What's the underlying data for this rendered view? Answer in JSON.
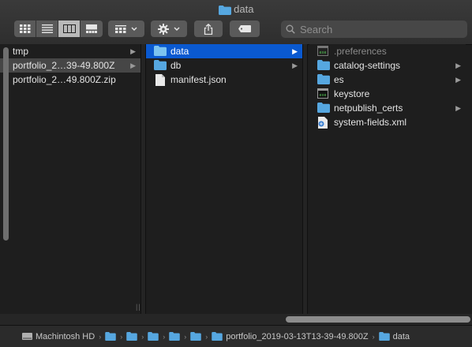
{
  "window": {
    "title": "data"
  },
  "toolbar": {
    "views": [
      "icon-view",
      "list-view",
      "column-view",
      "gallery-view"
    ],
    "active_view": "column-view",
    "group_button": "group-by",
    "action_button": "action-gear",
    "share_button": "share",
    "tag_button": "tags"
  },
  "search": {
    "placeholder": "Search",
    "value": ""
  },
  "columns": [
    {
      "items": [
        {
          "label": "tmp",
          "kind": "folder",
          "arrow": true
        },
        {
          "label": "portfolio_2…39-49.800Z",
          "kind": "folder",
          "arrow": true,
          "state": "parentsel"
        },
        {
          "label": "portfolio_2…49.800Z.zip",
          "kind": "file",
          "arrow": false
        }
      ]
    },
    {
      "items": [
        {
          "label": "data",
          "kind": "folder",
          "arrow": true,
          "state": "sel"
        },
        {
          "label": "db",
          "kind": "folder",
          "arrow": true
        },
        {
          "label": "manifest.json",
          "kind": "doc",
          "arrow": false
        }
      ]
    },
    {
      "items": [
        {
          "label": ".preferences",
          "kind": "exec",
          "arrow": false,
          "state": "dim"
        },
        {
          "label": "catalog-settings",
          "kind": "folder",
          "arrow": true
        },
        {
          "label": "es",
          "kind": "folder",
          "arrow": true
        },
        {
          "label": "keystore",
          "kind": "exec",
          "arrow": false
        },
        {
          "label": "netpublish_certs",
          "kind": "folder",
          "arrow": true
        },
        {
          "label": "system-fields.xml",
          "kind": "xml",
          "arrow": false
        }
      ]
    }
  ],
  "pathbar": [
    {
      "label": "Machintosh HD",
      "kind": "disk"
    },
    {
      "label": "",
      "kind": "folder"
    },
    {
      "label": "",
      "kind": "folder"
    },
    {
      "label": "",
      "kind": "folder"
    },
    {
      "label": "",
      "kind": "folder"
    },
    {
      "label": "",
      "kind": "folder"
    },
    {
      "label": "portfolio_2019-03-13T13-39-49.800Z",
      "kind": "folder"
    },
    {
      "label": "data",
      "kind": "folder"
    }
  ],
  "colors": {
    "selection": "#0a59d0",
    "folder": "#56a7e0",
    "background": "#1e1e1e"
  }
}
